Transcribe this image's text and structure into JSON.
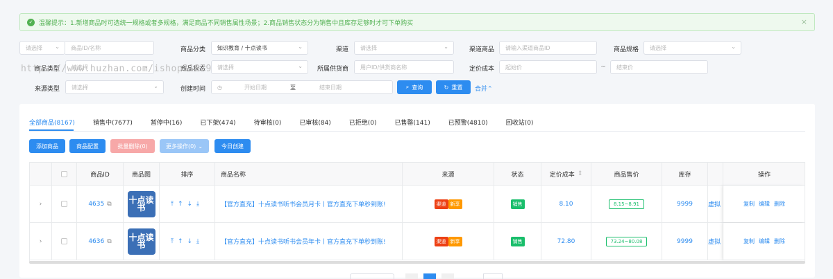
{
  "alert": {
    "text": "温馨提示：1.新增商品时可选统一规格或者多规格，满足商品不同销售属性场景；2.商品销售状态分为销售中且库存足够时才可下单购买"
  },
  "filters": {
    "search_type_placeholder": "请选择",
    "search_placeholder": "商品ID/名称",
    "category_label": "商品分类",
    "category_value": "知识教育 / 十点读书",
    "channel_label": "渠道",
    "channel_placeholder": "请选择",
    "channel_goods_label": "渠道商品",
    "channel_goods_placeholder": "请输入渠道商品ID",
    "spec_label": "商品规格",
    "spec_placeholder": "请选择",
    "goods_type_label": "商品类型",
    "goods_type_placeholder": "请选择",
    "status_label": "商品状态",
    "status_placeholder": "请选择",
    "supplier_label": "所属供货商",
    "supplier_placeholder": "用户ID/供货商名称",
    "cost_label": "定价成本",
    "cost_min_placeholder": "起始价",
    "cost_sep": "~",
    "cost_max_placeholder": "结束价",
    "source_label": "来源类型",
    "source_placeholder": "请选择",
    "created_label": "创建时间",
    "start_placeholder": "开始日期",
    "date_sep": "至",
    "end_placeholder": "结束日期",
    "query_button": "查询",
    "reset_button": "重置",
    "collapse_link": "合并"
  },
  "watermark": "https://www.huzhan.com/ishop31879",
  "tabs": [
    "全部商品(8167)",
    "销售中(7677)",
    "暂停中(16)",
    "已下架(474)",
    "待审核(0)",
    "已审核(84)",
    "已拒绝(0)",
    "已售罄(141)",
    "已预警(4810)",
    "回收站(0)"
  ],
  "toolbar": {
    "add": "添加商品",
    "config": "商品配置",
    "batch_delete": "批量删除(0)",
    "more": "更多操作(0)",
    "today": "今日创建"
  },
  "columns": {
    "id": "商品ID",
    "image": "商品图",
    "sort": "排序",
    "name": "商品名称",
    "source": "来源",
    "status": "状态",
    "cost": "定价成本",
    "price": "商品售价",
    "stock": "库存",
    "ops": "操作"
  },
  "rows": [
    {
      "id": "4635",
      "thumb": "十点读书",
      "name": "【官方直充】十点读书听书会员月卡丨官方直充下单秒到账!",
      "source_a": "渠道",
      "source_b": "新享",
      "status": "销售",
      "cost": "8.10",
      "price": "8.15~8.91",
      "stock": "9999",
      "virtual": "虚拟",
      "op_copy": "复制",
      "op_edit": "编辑",
      "op_delete": "删除"
    },
    {
      "id": "4636",
      "thumb": "十点读书",
      "name": "【官方直充】十点读书听书会员年卡丨官方直充下单秒到账!",
      "source_a": "渠道",
      "source_b": "新享",
      "status": "销售",
      "cost": "72.80",
      "price": "73.24~80.08",
      "stock": "9999",
      "virtual": "虚拟",
      "op_copy": "复制",
      "op_edit": "编辑",
      "op_delete": "删除"
    }
  ],
  "colors": {
    "primary": "#2d8cf0",
    "success": "#19be6b",
    "danger": "#ed4014",
    "warning": "#ff9900"
  }
}
